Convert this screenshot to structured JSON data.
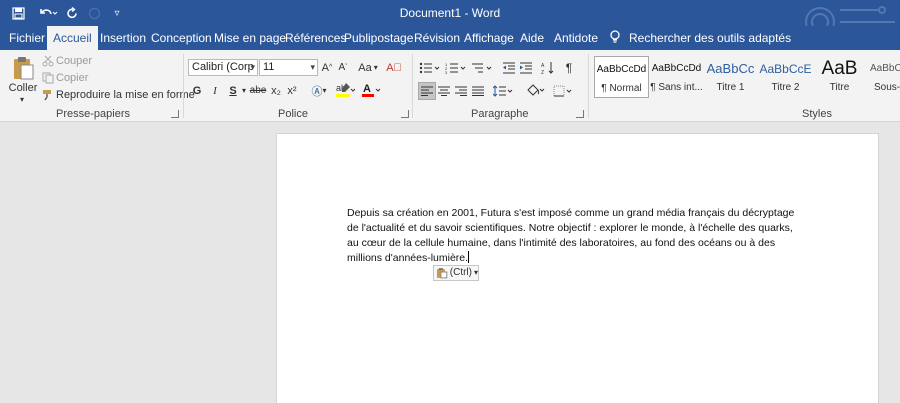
{
  "window": {
    "title": "Document1  -  Word"
  },
  "qat": {
    "save_icon": "save-icon",
    "undo_icon": "undo-icon",
    "redo_icon": "redo-icon",
    "customize_icon": "customize-qat-icon"
  },
  "tabs": [
    {
      "label": "Fichier"
    },
    {
      "label": "Accueil",
      "active": true
    },
    {
      "label": "Insertion"
    },
    {
      "label": "Conception"
    },
    {
      "label": "Mise en page"
    },
    {
      "label": "Références"
    },
    {
      "label": "Publipostage"
    },
    {
      "label": "Révision"
    },
    {
      "label": "Affichage"
    },
    {
      "label": "Aide"
    },
    {
      "label": "Antidote"
    }
  ],
  "search": {
    "label": "Rechercher des outils adaptés"
  },
  "clipboard": {
    "paste_label": "Coller",
    "cut_label": "Couper",
    "copy_label": "Copier",
    "format_painter_label": "Reproduire la mise en forme",
    "group_label": "Presse-papiers"
  },
  "font": {
    "name": "Calibri (Corp",
    "size": "11",
    "bold": "G",
    "italic": "I",
    "underline": "S",
    "strike": "abe",
    "subscript": "x₂",
    "superscript": "x²",
    "change_case": "Aa",
    "group_label": "Police"
  },
  "paragraph": {
    "group_label": "Paragraphe"
  },
  "styles": {
    "group_label": "Styles",
    "items": [
      {
        "sample": "AaBbCcDd",
        "name": "¶ Normal"
      },
      {
        "sample": "AaBbCcDd",
        "name": "¶ Sans int..."
      },
      {
        "sample": "AaBbCc",
        "name": "Titre 1"
      },
      {
        "sample": "AaBbCcE",
        "name": "Titre 2"
      },
      {
        "sample": "AaB",
        "name": "Titre"
      },
      {
        "sample": "AaBbC",
        "name": "Sous-t"
      }
    ]
  },
  "document": {
    "body": "Depuis sa création en 2001, Futura s'est imposé comme un grand média français du décryptage de l'actualité et du savoir scientifiques. Notre objectif : explorer le monde, à l'échelle des quarks, au cœur de la cellule humaine, dans l'intimité des laboratoires, au fond des océans ou à des millions d'années-lumière.",
    "paste_options_label": "(Ctrl)"
  },
  "colors": {
    "accent": "#2b579a",
    "ribbon_bg": "#f3f3f3",
    "workspace_bg": "#e6e6e6",
    "highlight": "#ffff00",
    "font_color": "#ff0000"
  }
}
